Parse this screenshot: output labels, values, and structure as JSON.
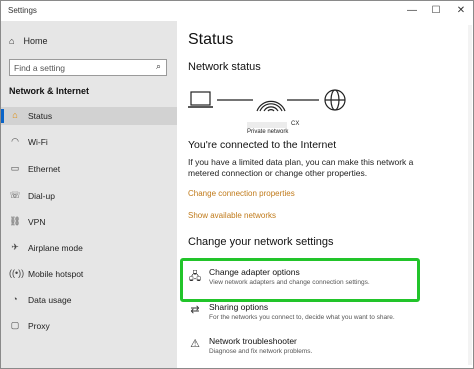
{
  "window": {
    "title": "Settings",
    "minimize": "—",
    "maximize": "☐",
    "close": "✕"
  },
  "sidebar": {
    "home": "Home",
    "search_placeholder": "Find a setting",
    "section": "Network & Internet",
    "items": [
      {
        "label": "Status",
        "icon": "status-icon",
        "active": true
      },
      {
        "label": "Wi-Fi",
        "icon": "wifi-icon"
      },
      {
        "label": "Ethernet",
        "icon": "ethernet-icon"
      },
      {
        "label": "Dial-up",
        "icon": "dialup-icon"
      },
      {
        "label": "VPN",
        "icon": "vpn-icon"
      },
      {
        "label": "Airplane mode",
        "icon": "airplane-icon"
      },
      {
        "label": "Mobile hotspot",
        "icon": "hotspot-icon"
      },
      {
        "label": "Data usage",
        "icon": "data-usage-icon"
      },
      {
        "label": "Proxy",
        "icon": "proxy-icon"
      }
    ]
  },
  "main": {
    "title": "Status",
    "network_status_heading": "Network status",
    "network_name_suffix": "CX",
    "network_type": "Private network",
    "connected_heading": "You're connected to the Internet",
    "connected_text": "If you have a limited data plan, you can make this network a metered connection or change other properties.",
    "link_change_props": "Change connection properties",
    "link_show_networks": "Show available networks",
    "change_settings_heading": "Change your network settings",
    "options": [
      {
        "title": "Change adapter options",
        "desc": "View network adapters and change connection settings."
      },
      {
        "title": "Sharing options",
        "desc": "For the networks you connect to, decide what you want to share."
      },
      {
        "title": "Network troubleshooter",
        "desc": "Diagnose and fix network problems."
      }
    ],
    "highlight_color": "#22c42a",
    "accent_color": "#0a64c8",
    "link_color": "#c07a1a"
  }
}
